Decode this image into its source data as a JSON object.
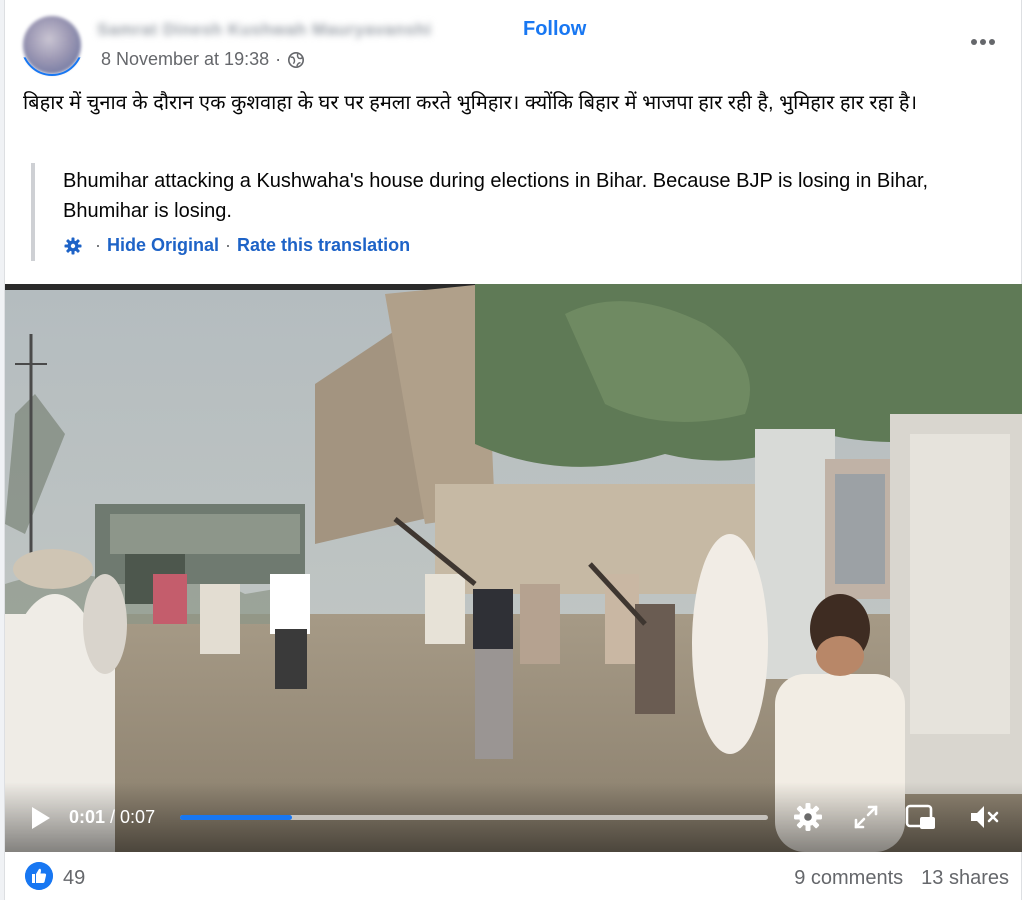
{
  "post": {
    "author_name": "Samrat Dinesh Kushwah Mauryavanshi",
    "follow_label": "Follow",
    "timestamp": "8 November at 19:38",
    "meta_sep": "·",
    "privacy_icon": "globe-icon",
    "more_icon": "more-options-icon",
    "text_hindi": "बिहार में चुनाव के दौरान एक कुशवाहा के घर पर हमला करते भुमिहार। क्योंकि बिहार में भाजपा हार रही है, भुमिहार हार रहा है।",
    "translation": {
      "text": "Bhumihar attacking a Kushwaha's house during elections in Bihar. Because BJP is losing in Bihar, Bhumihar is losing.",
      "settings_icon": "gear-icon",
      "sep": "·",
      "hide_original_label": "Hide Original",
      "rate_label": "Rate this translation"
    }
  },
  "video": {
    "current_time": "0:01",
    "time_sep": " / ",
    "duration": "0:07",
    "progress_fraction": 0.19,
    "icons": [
      "play-icon",
      "settings-icon",
      "fullscreen-icon",
      "picture-in-picture-icon",
      "mute-icon"
    ]
  },
  "footer": {
    "like_count": "49",
    "comments": "9 comments",
    "shares": "13 shares"
  },
  "colors": {
    "accent": "#1877f2",
    "secondary_text": "#65676b",
    "link": "#1e63c7"
  }
}
